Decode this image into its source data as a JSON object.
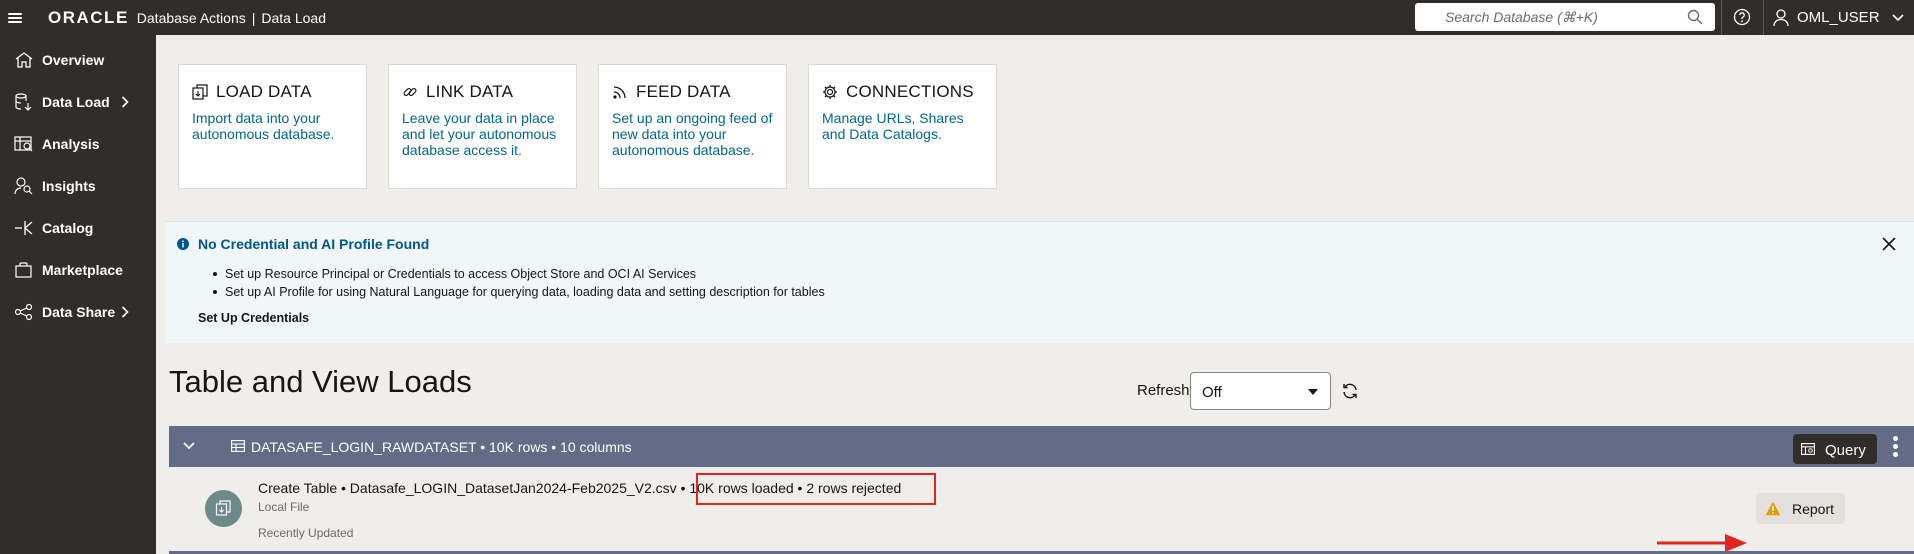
{
  "topbar": {
    "logo": "ORACLE",
    "app_title": "Database Actions",
    "separator": "|",
    "page": "Data Load",
    "search_placeholder": "Search Database (⌘+K)",
    "user": "OML_USER"
  },
  "sidebar": {
    "items": [
      {
        "label": "Overview",
        "icon": "home-icon"
      },
      {
        "label": "Data Load",
        "icon": "data-load-icon",
        "has_submenu": true
      },
      {
        "label": "Analysis",
        "icon": "analysis-icon"
      },
      {
        "label": "Insights",
        "icon": "insights-icon"
      },
      {
        "label": "Catalog",
        "icon": "catalog-icon"
      },
      {
        "label": "Marketplace",
        "icon": "marketplace-icon"
      },
      {
        "label": "Data Share",
        "icon": "data-share-icon",
        "has_submenu": true
      }
    ]
  },
  "cards": [
    {
      "title": "LOAD DATA",
      "desc": "Import data into your autonomous database.",
      "icon": "load-data-icon"
    },
    {
      "title": "LINK DATA",
      "desc": "Leave your data in place and let your autonomous database access it.",
      "icon": "link-icon"
    },
    {
      "title": "FEED DATA",
      "desc": "Set up an ongoing feed of new data into your autonomous database.",
      "icon": "feed-icon"
    },
    {
      "title": "CONNECTIONS",
      "desc": "Manage URLs, Shares and Data Catalogs.",
      "icon": "gear-icon"
    }
  ],
  "banner": {
    "title": "No Credential and AI Profile Found",
    "items": [
      "Set up Resource Principal or Credentials to access Object Store and OCI AI Services",
      "Set up AI Profile for using Natural Language for querying data, loading data and setting description for tables"
    ],
    "link": "Set Up Credentials"
  },
  "section": {
    "title": "Table and View Loads",
    "refresh_label": "Refresh",
    "refresh_value": "Off"
  },
  "group": {
    "title": "DATASAFE_LOGIN_RAWDATASET • 10K rows • 10 columns",
    "query_label": "Query"
  },
  "load": {
    "line1_prefix": "Create Table • Datasafe_LOGIN_DatasetJan2024-Feb2025_V2.csv • ",
    "line1_highlight": "10K rows loaded • 2 rows rejected",
    "source": "Local File",
    "status": "Recently Updated",
    "report_label": "Report"
  },
  "colors": {
    "accent_link": "#00688c",
    "group_bar": "#636b87",
    "highlight": "#e0261f",
    "warning": "#ea9b00"
  }
}
